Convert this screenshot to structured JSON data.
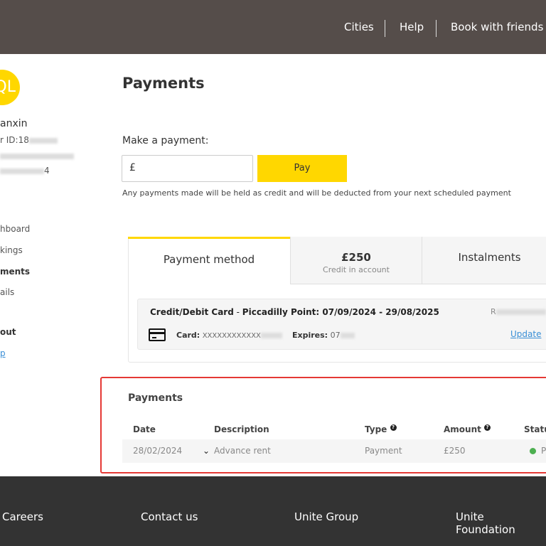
{
  "header": {
    "nav": [
      "Cities",
      "Help",
      "Book with friends"
    ]
  },
  "sidebar": {
    "avatar_initials": "QL",
    "name": "anxin",
    "user_id_prefix": "r ID:18",
    "email_suffix": "",
    "phone_suffix": "4",
    "items": [
      "hboard",
      "kings",
      "ments",
      "ails",
      "out",
      "p"
    ],
    "active_item": "ments"
  },
  "main": {
    "title": "Payments",
    "make_payment_label": "Make a payment:",
    "currency_symbol": "£",
    "pay_button": "Pay",
    "note": "Any payments made will be held as credit and will be deducted from your next scheduled payment",
    "tabs": [
      {
        "label": "Payment method"
      },
      {
        "label": "£250",
        "sublabel": "Credit in account"
      },
      {
        "label": "Instalments"
      }
    ],
    "card": {
      "title": "Credit/Debit Card",
      "separator": " - ",
      "booking": "Piccadilly Point: 07/09/2024 - 29/08/2025",
      "ref_prefix": "R",
      "card_label": "Card:",
      "card_value": "XXXXXXXXXXXX",
      "expires_label": "Expires:",
      "expires_value": "07",
      "update_link": "Update"
    },
    "payments": {
      "title": "Payments",
      "columns": [
        "Date",
        "Description",
        "Type",
        "Amount",
        "Status"
      ],
      "rows": [
        {
          "date": "28/02/2024",
          "description": "Advance rent",
          "type": "Payment",
          "amount": "£250",
          "status": "P"
        }
      ]
    }
  },
  "footer": {
    "links": [
      "Careers",
      "Contact us",
      "Unite Group",
      "Unite Foundation"
    ]
  },
  "colors": {
    "header": "#554d4a",
    "accent": "#ffd700",
    "highlight": "#e53935",
    "footer": "#333333",
    "status_ok": "#4caf50"
  }
}
